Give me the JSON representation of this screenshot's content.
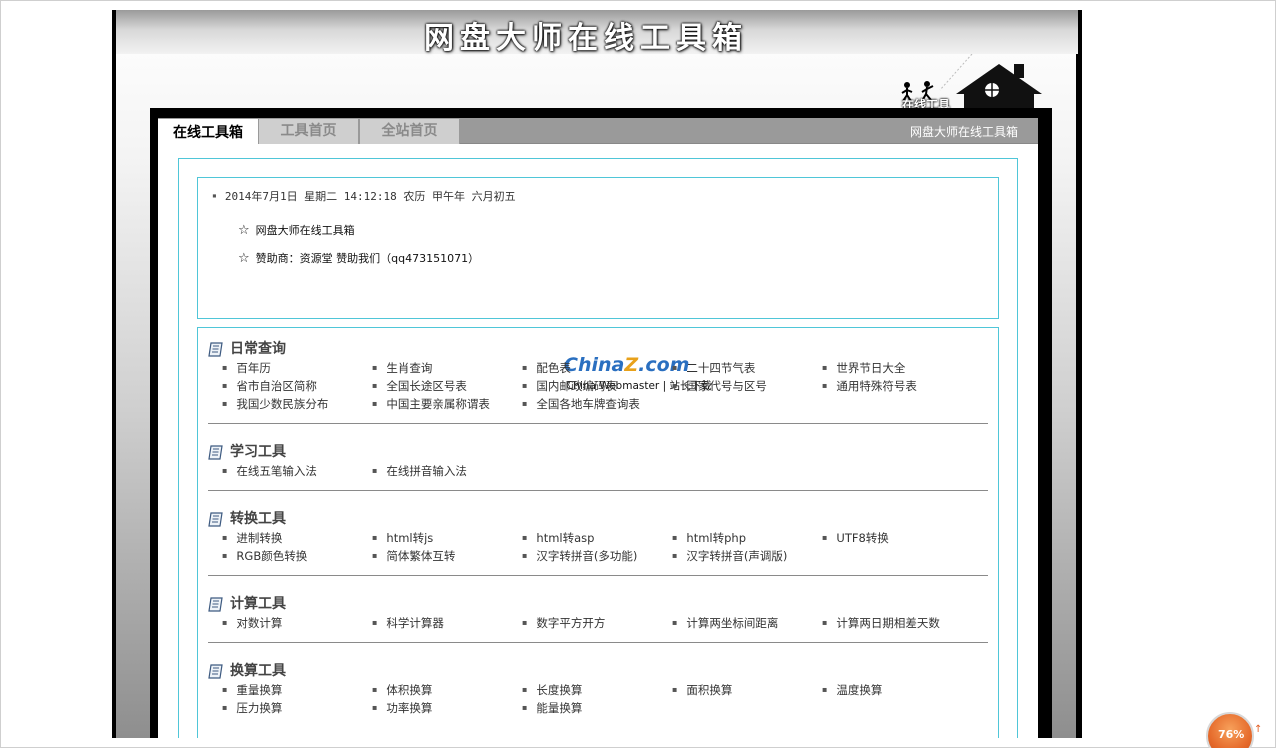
{
  "banner": {
    "title": "网盘大师在线工具箱"
  },
  "house": {
    "label": "在线工具"
  },
  "tabs": {
    "active": "在线工具箱",
    "home": "工具首页",
    "site_home": "全站首页",
    "right_text": "网盘大师在线工具箱"
  },
  "info": {
    "datetime": "2014年7月1日 星期二 14:12:18 农历 甲午年 六月初五",
    "star": "☆",
    "line1": "网盘大师在线工具箱",
    "line2": "赞助商：资源堂 赞助我们（qq473151071）"
  },
  "sections": [
    {
      "title": "日常查询",
      "items": [
        "百年历",
        "生肖查询",
        "配色表",
        "二十四节气表",
        "世界节日大全",
        "省市自治区简称",
        "全国长途区号表",
        "国内邮政编码表",
        "国家代号与区号",
        "通用特殊符号表",
        "我国少数民族分布",
        "中国主要亲属称谓表",
        "全国各地车牌查询表"
      ]
    },
    {
      "title": "学习工具",
      "items": [
        "在线五笔输入法",
        "在线拼音输入法"
      ]
    },
    {
      "title": "转换工具",
      "items": [
        "进制转换",
        "html转js",
        "html转asp",
        "html转php",
        "UTF8转换",
        "RGB颜色转换",
        "简体繁体互转",
        "汉字转拼音(多功能)",
        "汉字转拼音(声调版)"
      ]
    },
    {
      "title": "计算工具",
      "items": [
        "对数计算",
        "科学计算器",
        "数字平方开方",
        "计算两坐标间距离",
        "计算两日期相差天数"
      ]
    },
    {
      "title": "换算工具",
      "items": [
        "重量换算",
        "体积换算",
        "长度换算",
        "面积换算",
        "温度换算",
        "压力换算",
        "功率换算",
        "能量换算"
      ]
    }
  ],
  "watermark": {
    "logo_a": "China",
    "logo_z": "Z",
    "logo_b": ".com",
    "sub": "China Webmaster | 站长下载"
  },
  "zoom": {
    "value": "76%"
  },
  "colors": {
    "accent_border": "#4fc6d8",
    "tab_bar": "#9a9a9a",
    "zoom_badge": "#e5692a"
  },
  "icons": [
    "book-icon",
    "house-icon",
    "stick-figures-icon",
    "zoom-arrow-icon"
  ]
}
